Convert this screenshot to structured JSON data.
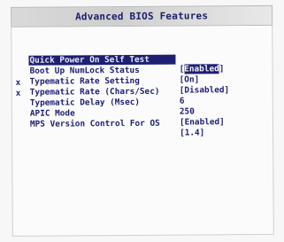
{
  "title": "Advanced BIOS Features",
  "items": [
    {
      "marker": "",
      "label": "Quick Power On Self Test",
      "value_open": "[",
      "value_inner": "Enabled",
      "value_close": "]",
      "selected": true
    },
    {
      "marker": "",
      "label": "Boot Up NumLock Status",
      "value_open": "[",
      "value_inner": "On",
      "value_close": "]",
      "selected": false
    },
    {
      "marker": "",
      "label": "Typematic Rate Setting",
      "value_open": "[",
      "value_inner": "Disabled",
      "value_close": "]",
      "selected": false
    },
    {
      "marker": "x",
      "label": "Typematic Rate (Chars/Sec)",
      "value_open": "",
      "value_inner": "6",
      "value_close": "",
      "selected": false
    },
    {
      "marker": "x",
      "label": "Typematic Delay (Msec)",
      "value_open": "",
      "value_inner": "250",
      "value_close": "",
      "selected": false
    },
    {
      "marker": "",
      "label": "APIC Mode",
      "value_open": "[",
      "value_inner": "Enabled",
      "value_close": "]",
      "selected": false
    },
    {
      "marker": "",
      "label": "MPS Version Control For OS",
      "value_open": "[",
      "value_inner": "1.4",
      "value_close": "]",
      "selected": false
    }
  ]
}
